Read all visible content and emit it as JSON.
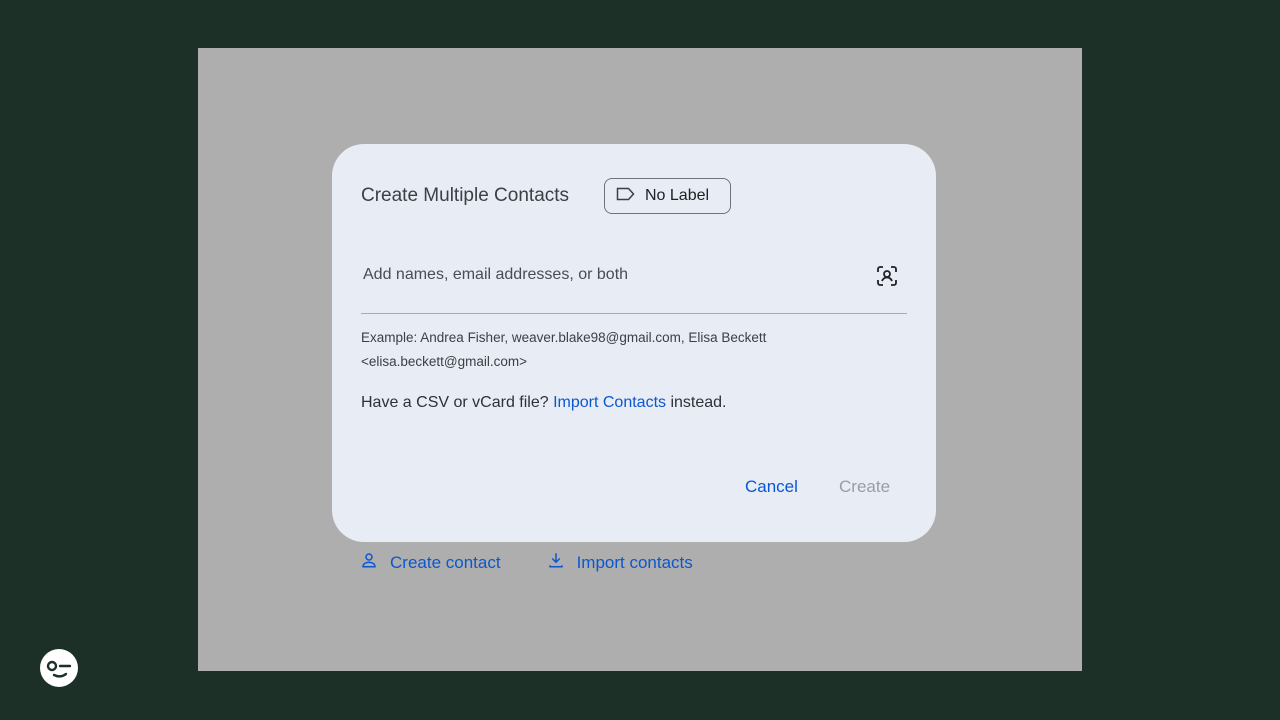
{
  "background": {
    "actions": [
      {
        "label": "Create contact",
        "icon": "person-icon"
      },
      {
        "label": "Import contacts",
        "icon": "download-icon"
      }
    ]
  },
  "dialog": {
    "title": "Create Multiple Contacts",
    "label_chip": {
      "text": "No Label",
      "icon": "label-icon"
    },
    "input": {
      "placeholder": "Add names, email addresses, or both",
      "value": "",
      "icon": "contact-picker-icon"
    },
    "example": "Example: Andrea Fisher, weaver.blake98@gmail.com, Elisa Beckett <elisa.beckett@gmail.com>",
    "csv": {
      "prefix": "Have a CSV or vCard file? ",
      "link": "Import Contacts",
      "suffix": " instead."
    },
    "buttons": {
      "cancel": "Cancel",
      "create": "Create"
    }
  },
  "colors": {
    "accent": "#0b57d0",
    "dialog_bg": "#e8ecf4",
    "page_bg": "#1c3028",
    "disabled": "#9a9ea3"
  }
}
